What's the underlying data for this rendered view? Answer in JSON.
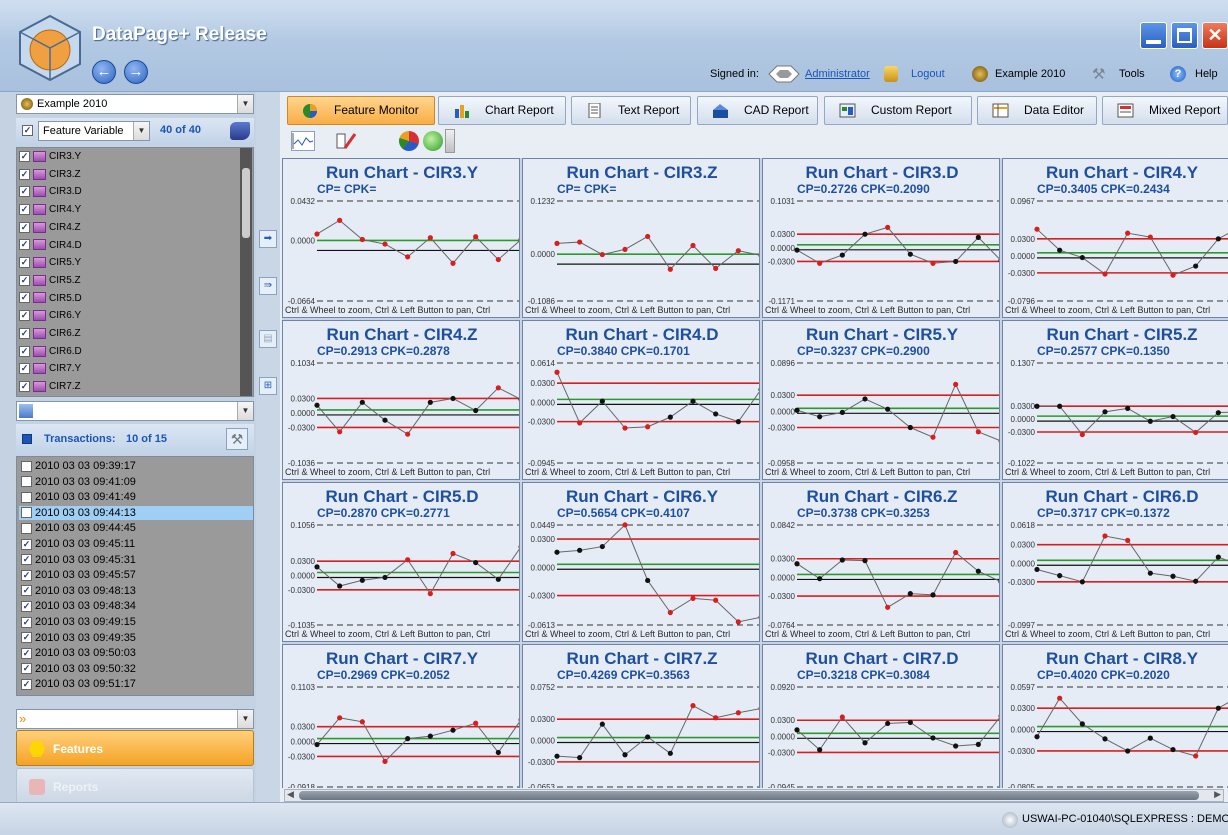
{
  "app": {
    "title": "DataPage+ Release"
  },
  "signin": {
    "label": "Signed in:",
    "user": "Administrator",
    "logout": "Logout",
    "database": "Example 2010",
    "tools": "Tools",
    "help": "Help"
  },
  "left": {
    "db_select": "Example 2010",
    "filter_select": "Feature Variable",
    "feature_count": "40 of 40",
    "features": [
      "CIR3.Y",
      "CIR3.Z",
      "CIR3.D",
      "CIR4.Y",
      "CIR4.Z",
      "CIR4.D",
      "CIR5.Y",
      "CIR5.Z",
      "CIR5.D",
      "CIR6.Y",
      "CIR6.Z",
      "CIR6.D",
      "CIR7.Y",
      "CIR7.Z"
    ],
    "transactions_label": "Transactions:",
    "transactions_count": "10 of 15",
    "transactions": [
      {
        "t": "2010 03 03 09:39:17",
        "checked": false
      },
      {
        "t": "2010 03 03 09:41:09",
        "checked": false
      },
      {
        "t": "2010 03 03 09:41:49",
        "checked": false
      },
      {
        "t": "2010 03 03 09:44:13",
        "checked": false,
        "selected": true
      },
      {
        "t": "2010 03 03 09:44:45",
        "checked": false
      },
      {
        "t": "2010 03 03 09:45:11",
        "checked": true
      },
      {
        "t": "2010 03 03 09:45:31",
        "checked": true
      },
      {
        "t": "2010 03 03 09:45:57",
        "checked": true
      },
      {
        "t": "2010 03 03 09:48:13",
        "checked": true
      },
      {
        "t": "2010 03 03 09:48:34",
        "checked": true
      },
      {
        "t": "2010 03 03 09:49:15",
        "checked": true
      },
      {
        "t": "2010 03 03 09:49:35",
        "checked": true
      },
      {
        "t": "2010 03 03 09:50:03",
        "checked": true
      },
      {
        "t": "2010 03 03 09:50:32",
        "checked": true
      },
      {
        "t": "2010 03 03 09:51:17",
        "checked": true
      }
    ],
    "nav_features": "Features",
    "nav_reports": "Reports"
  },
  "tabs": [
    "Feature Monitor",
    "Chart Report",
    "Text Report",
    "CAD Report",
    "Custom Report",
    "Data Editor",
    "Mixed Report"
  ],
  "hint": "Ctrl & Wheel to zoom, Ctrl & Left Button to pan, Ctrl",
  "status": "USWAI-PC-01040\\SQLEXPRESS : DEMO",
  "colors": {
    "accent": "#1e4fa0",
    "limit_red": "#d81e1e",
    "nominal_green": "#2a9a2a"
  },
  "charts": [
    {
      "title": "Run Chart - CIR3.Y",
      "stats": "CP=   CPK=",
      "top": "0.0432",
      "bot": "-0.0664",
      "mid": [
        "0.0000"
      ],
      "pts": [
        0.007,
        0.022,
        0.001,
        -0.004,
        -0.018,
        0.003,
        -0.025,
        0.004,
        -0.021,
        0.001
      ],
      "limits": null
    },
    {
      "title": "Run Chart - CIR3.Z",
      "stats": "CP=   CPK=",
      "top": "0.1232",
      "bot": "-0.1086",
      "mid": [
        "0.0000"
      ],
      "pts": [
        0.025,
        0.028,
        -0.001,
        0.011,
        0.041,
        -0.035,
        0.02,
        -0.033,
        0.008,
        -0.003
      ],
      "limits": null
    },
    {
      "title": "Run Chart - CIR3.D",
      "stats": "CP=0.2726   CPK=0.2090",
      "top": "0.1031",
      "bot": "-0.1171",
      "mid": [
        "0.0300",
        "0.0000",
        "-0.0300"
      ],
      "pts": [
        -0.005,
        -0.034,
        -0.016,
        0.03,
        0.045,
        -0.014,
        -0.034,
        -0.03,
        0.023,
        -0.028
      ],
      "limits": [
        0.03,
        -0.03
      ]
    },
    {
      "title": "Run Chart - CIR4.Y",
      "stats": "CP=0.3405   CPK=0.2434",
      "top": "0.0967",
      "bot": "-0.0796",
      "mid": [
        "0.0300",
        "0.0000",
        "-0.0300"
      ],
      "pts": [
        0.047,
        0.01,
        -0.003,
        -0.032,
        0.04,
        0.033,
        -0.034,
        -0.018,
        0.03,
        0.052
      ],
      "limits": [
        0.03,
        -0.03
      ]
    },
    {
      "title": "Run Chart - CIR4.Z",
      "stats": "CP=0.2913   CPK=0.2878",
      "top": "0.1034",
      "bot": "-0.1036",
      "mid": [
        "0.0300",
        "0.0000",
        "-0.0300"
      ],
      "pts": [
        0.016,
        -0.039,
        0.022,
        -0.015,
        -0.044,
        0.022,
        0.03,
        0.005,
        0.052,
        0.028
      ],
      "limits": [
        0.03,
        -0.03
      ]
    },
    {
      "title": "Run Chart - CIR4.D",
      "stats": "CP=0.3840   CPK=0.1701",
      "top": "0.0614",
      "bot": "-0.0945",
      "mid": [
        "0.0300",
        "0.0000",
        "-0.0300"
      ],
      "pts": [
        0.047,
        -0.032,
        0.002,
        -0.04,
        -0.038,
        -0.023,
        0.002,
        -0.018,
        -0.03,
        0.02
      ],
      "limits": [
        0.03,
        -0.03
      ]
    },
    {
      "title": "Run Chart - CIR5.Y",
      "stats": "CP=0.3237   CPK=0.2900",
      "top": "0.0896",
      "bot": "-0.0958",
      "mid": [
        "0.0300",
        "0.0000",
        "-0.0300"
      ],
      "pts": [
        0.002,
        -0.01,
        -0.002,
        0.023,
        0.004,
        -0.03,
        -0.048,
        0.05,
        -0.038,
        -0.055
      ],
      "limits": [
        0.03,
        -0.03
      ]
    },
    {
      "title": "Run Chart - CIR5.Z",
      "stats": "CP=0.2577   CPK=0.1350",
      "top": "0.1307",
      "bot": "-0.1022",
      "mid": [
        "0.0300",
        "0.0000",
        "-0.0300"
      ],
      "pts": [
        0.03,
        0.03,
        -0.036,
        0.017,
        0.025,
        -0.005,
        0.006,
        -0.031,
        0.015,
        0.017
      ],
      "limits": [
        0.03,
        -0.03
      ]
    },
    {
      "title": "Run Chart - CIR5.D",
      "stats": "CP=0.2870   CPK=0.2771",
      "top": "0.1056",
      "bot": "-0.1035",
      "mid": [
        "0.0300",
        "0.0000",
        "-0.0300"
      ],
      "pts": [
        0.018,
        -0.022,
        -0.01,
        -0.004,
        0.033,
        -0.038,
        0.046,
        0.027,
        -0.008,
        0.06
      ],
      "limits": [
        0.03,
        -0.03
      ]
    },
    {
      "title": "Run Chart - CIR6.Y",
      "stats": "CP=0.5654   CPK=0.4107",
      "top": "0.0449",
      "bot": "-0.0613",
      "mid": [
        "0.0300",
        "0.0000",
        "-0.0300"
      ],
      "pts": [
        0.016,
        0.018,
        0.022,
        0.045,
        -0.014,
        -0.048,
        -0.033,
        -0.035,
        -0.058,
        -0.053
      ],
      "limits": [
        0.03,
        -0.03
      ]
    },
    {
      "title": "Run Chart - CIR6.Z",
      "stats": "CP=0.3738   CPK=0.3253",
      "top": "0.0842",
      "bot": "-0.0764",
      "mid": [
        "0.0300",
        "0.0000",
        "-0.0300"
      ],
      "pts": [
        0.022,
        -0.002,
        0.028,
        0.027,
        -0.048,
        -0.026,
        -0.028,
        0.04,
        0.01,
        -0.007
      ],
      "limits": [
        0.03,
        -0.03
      ]
    },
    {
      "title": "Run Chart - CIR6.D",
      "stats": "CP=0.3717   CPK=0.1372",
      "top": "0.0618",
      "bot": "-0.0997",
      "mid": [
        "0.0300",
        "0.0000",
        "-0.0300"
      ],
      "pts": [
        -0.01,
        -0.02,
        -0.03,
        0.044,
        0.037,
        -0.016,
        -0.021,
        -0.029,
        0.01,
        -0.004
      ],
      "limits": [
        0.03,
        -0.03
      ]
    },
    {
      "title": "Run Chart - CIR7.Y",
      "stats": "CP=0.2969   CPK=0.2052",
      "top": "0.1103",
      "bot": "-0.0918",
      "mid": [
        "0.0300",
        "0.0000",
        "-0.0300"
      ],
      "pts": [
        -0.006,
        0.048,
        0.04,
        -0.04,
        0.006,
        0.011,
        0.023,
        0.037,
        -0.022,
        0.044
      ],
      "limits": [
        0.03,
        -0.03
      ]
    },
    {
      "title": "Run Chart - CIR7.Z",
      "stats": "CP=0.4269   CPK=0.3563",
      "top": "0.0752",
      "bot": "-0.0653",
      "mid": [
        "0.0300",
        "0.0000",
        "-0.0300"
      ],
      "pts": [
        -0.022,
        -0.024,
        0.023,
        -0.02,
        0.005,
        -0.018,
        0.049,
        0.032,
        0.039,
        0.045
      ],
      "limits": [
        0.03,
        -0.03
      ]
    },
    {
      "title": "Run Chart - CIR7.D",
      "stats": "CP=0.3218   CPK=0.3084",
      "top": "0.0920",
      "bot": "-0.0945",
      "mid": [
        "0.0300",
        "0.0000",
        "-0.0300"
      ],
      "pts": [
        0.012,
        -0.025,
        0.036,
        -0.012,
        0.024,
        0.026,
        -0.003,
        -0.018,
        -0.015,
        0.038
      ],
      "limits": [
        0.03,
        -0.03
      ]
    },
    {
      "title": "Run Chart - CIR8.Y",
      "stats": "CP=0.4020   CPK=0.2020",
      "top": "0.0597",
      "bot": "-0.0805",
      "mid": [
        "0.0300",
        "0.0000",
        "-0.0300"
      ],
      "pts": [
        -0.01,
        0.044,
        0.008,
        -0.013,
        -0.03,
        -0.012,
        -0.028,
        -0.037,
        0.03,
        0.048
      ],
      "limits": [
        0.03,
        -0.03
      ]
    }
  ]
}
